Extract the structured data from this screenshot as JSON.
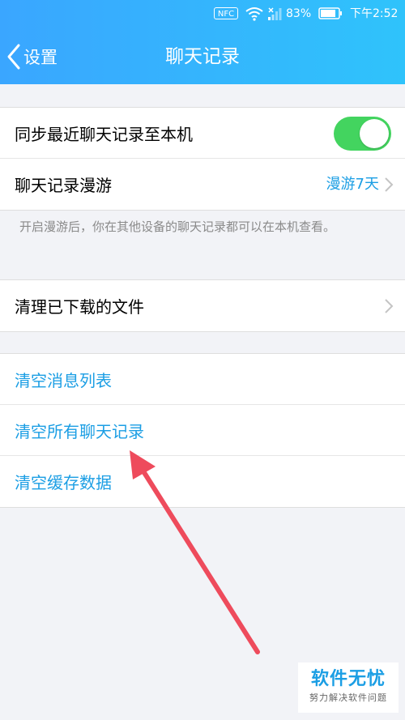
{
  "status_bar": {
    "nfc": "NFC",
    "battery": "83%",
    "time": "下午2:52"
  },
  "nav": {
    "back_label": "设置",
    "title": "聊天记录"
  },
  "sections": {
    "sync": {
      "label": "同步最近聊天记录至本机",
      "toggle_on": true
    },
    "roaming": {
      "label": "聊天记录漫游",
      "value": "漫游7天"
    },
    "hint": "开启漫游后，你在其他设备的聊天记录都可以在本机查看。",
    "cleanup": {
      "label": "清理已下载的文件"
    },
    "actions": [
      {
        "label": "清空消息列表"
      },
      {
        "label": "清空所有聊天记录"
      },
      {
        "label": "清空缓存数据"
      }
    ]
  },
  "colors": {
    "header_start": "#3aa6ff",
    "header_end": "#2fc3fb",
    "toggle_on": "#43d45f",
    "action_blue": "#1b9ee4",
    "annotation_arrow": "#ee4b5c"
  },
  "watermark": {
    "title": "软件无忧",
    "subtitle": "努力解决软件问题"
  }
}
